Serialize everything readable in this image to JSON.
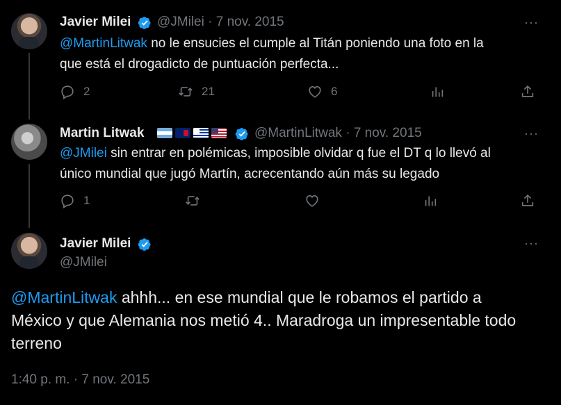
{
  "tweets": [
    {
      "name": "Javier Milei",
      "handle_date": "@JMilei · 7 nov. 2015",
      "mention": "@MartinLitwak",
      "text_line1": " no le ensucies el cumple al Titán poniendo una foto en la",
      "text_line2": "que está el drogadicto de puntuación perfecta...",
      "replies": "2",
      "retweets": "21",
      "likes": "6"
    },
    {
      "name": "Martin Litwak",
      "handle_date": "@MartinLitwak · 7 nov. 2015",
      "mention": "@JMilei",
      "text_line1": " sin entrar en polémicas, imposible olvidar q fue el DT q lo llevó al",
      "text_line2": "único mundial que jugó Martín, acrecentando aún más su legado",
      "replies": "1",
      "retweets": "",
      "likes": ""
    }
  ],
  "main_tweet": {
    "name": "Javier Milei",
    "handle": "@JMilei",
    "mention": "@MartinLitwak",
    "line1": " ahhh... en ese mundial que le robamos el partido a",
    "line2": "México y que Alemania nos metió 4.. Maradroga un impresentable todo",
    "line3": "terreno",
    "timestamp": "1:40 p. m. · 7 nov. 2015"
  },
  "more_label": "···",
  "icons": [
    "reply-icon",
    "retweet-icon",
    "like-icon",
    "views-icon",
    "share-icon",
    "verified-icon",
    "more-icon"
  ],
  "colors": {
    "background": "#000000",
    "text": "#e7e9ea",
    "muted": "#71767b",
    "link": "#1d9bf0",
    "verified": "#1d9bf0"
  }
}
